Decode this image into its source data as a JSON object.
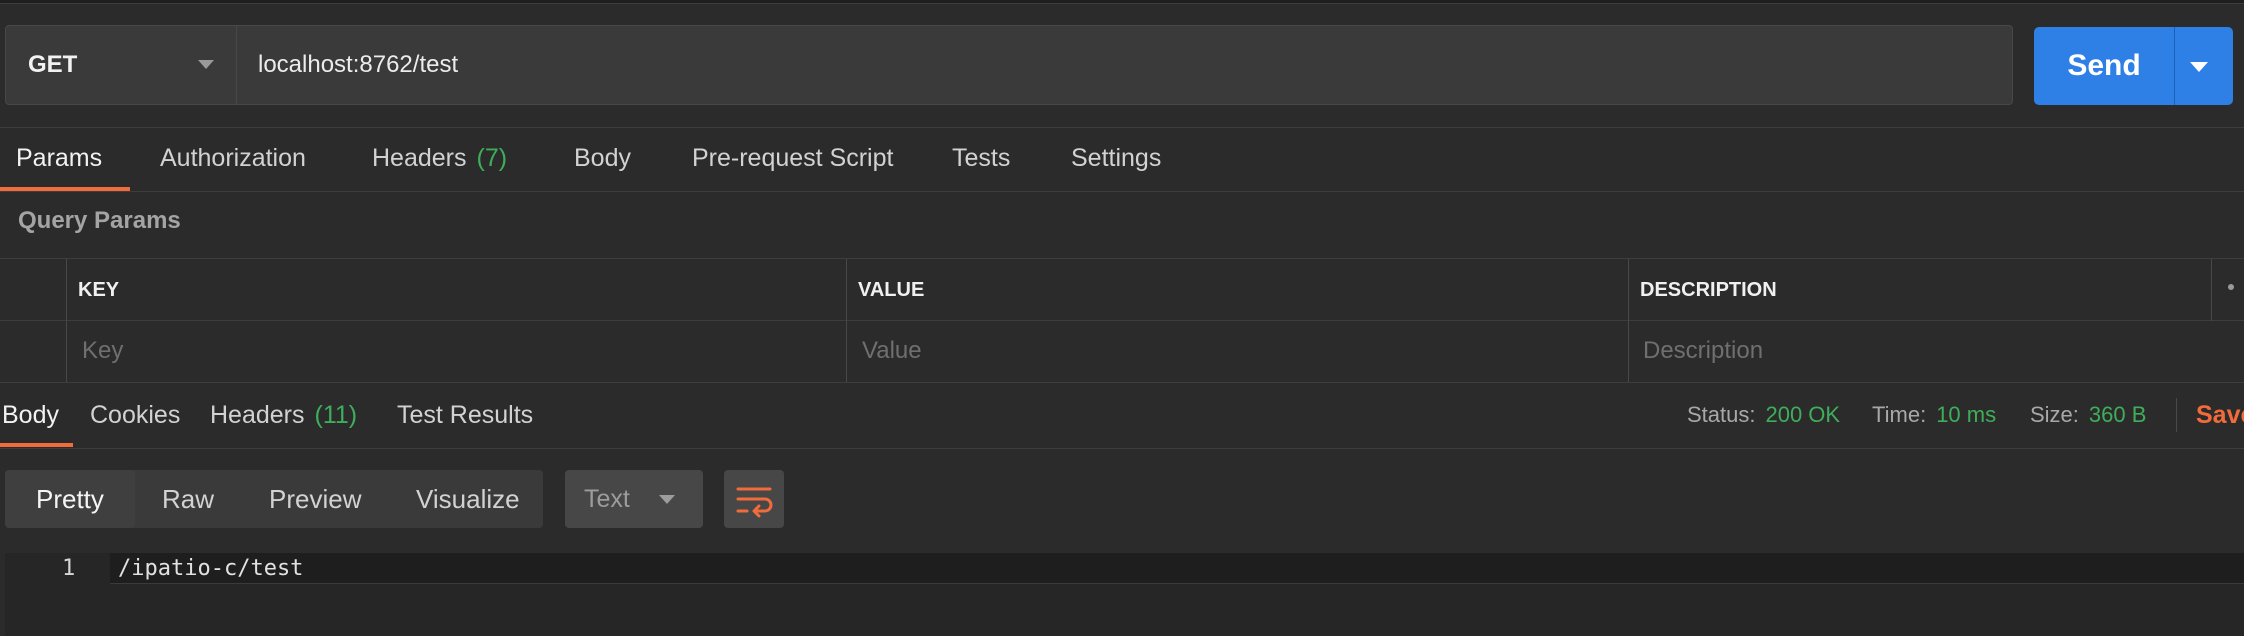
{
  "request": {
    "method": "GET",
    "url": "localhost:8762/test",
    "send_label": "Send"
  },
  "request_tabs": [
    {
      "label": "Params",
      "active": true
    },
    {
      "label": "Authorization"
    },
    {
      "label": "Headers",
      "count": "(7)"
    },
    {
      "label": "Body"
    },
    {
      "label": "Pre-request Script"
    },
    {
      "label": "Tests"
    },
    {
      "label": "Settings"
    }
  ],
  "query_params": {
    "title": "Query Params",
    "columns": [
      "KEY",
      "VALUE",
      "DESCRIPTION"
    ],
    "placeholders": [
      "Key",
      "Value",
      "Description"
    ]
  },
  "response_tabs": [
    {
      "label": "Body",
      "active": true
    },
    {
      "label": "Cookies"
    },
    {
      "label": "Headers",
      "count": "(11)"
    },
    {
      "label": "Test Results"
    }
  ],
  "response_meta": {
    "status_label": "Status:",
    "status_value": "200 OK",
    "time_label": "Time:",
    "time_value": "10 ms",
    "size_label": "Size:",
    "size_value": "360 B",
    "save_label": "Save"
  },
  "view_modes": [
    "Pretty",
    "Raw",
    "Preview",
    "Visualize"
  ],
  "format": "Text",
  "editor": {
    "lines": [
      {
        "number": "1",
        "text": "/ipatio-c/test"
      }
    ]
  },
  "colors": {
    "accent": "#f26b3a",
    "send": "#2e7fe6",
    "success": "#3fae5a",
    "background": "#2b2b2b"
  },
  "icons": [
    "dropdown-caret-icon",
    "wrap-lines-icon",
    "more-options-icon"
  ]
}
